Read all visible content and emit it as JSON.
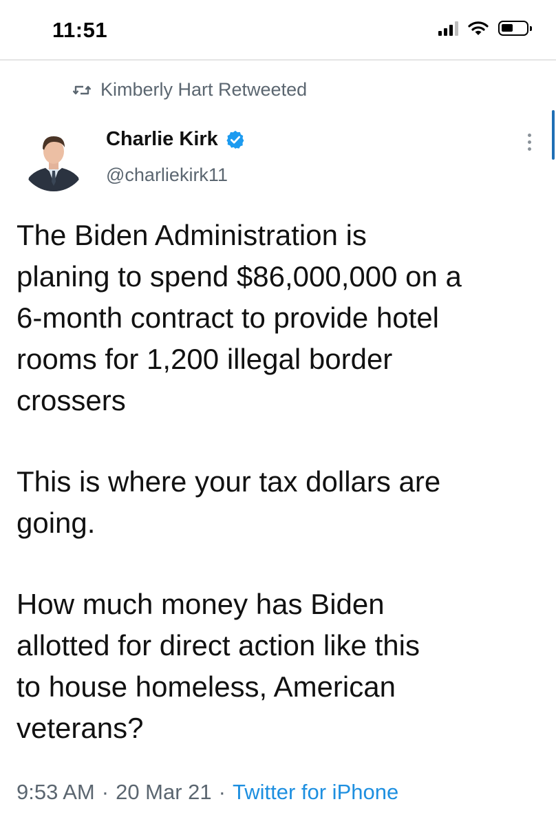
{
  "status_bar": {
    "time": "11:51",
    "icons": [
      "signal-bars-icon",
      "wifi-icon",
      "battery-icon"
    ]
  },
  "retweet": {
    "icon": "retweet-icon",
    "text": "Kimberly Hart Retweeted"
  },
  "author": {
    "display_name": "Charlie Kirk",
    "handle": "@charliekirk11",
    "verified": true,
    "verified_color": "#1d9bf0"
  },
  "tweet": {
    "paragraphs": [
      "The Biden Administration is\nplaning to spend $86,000,000 on a\n6-month contract to provide hotel\nrooms for 1,200 illegal border\ncrossers",
      "This is where your tax dollars are\ngoing.",
      "How much money has Biden\nallotted for direct action like this\nto house homeless, American\nveterans?"
    ]
  },
  "meta": {
    "time": "9:53 AM",
    "separator": "·",
    "date": "20 Mar 21",
    "source": "Twitter for iPhone"
  },
  "colors": {
    "link": "#1d8fe0",
    "muted_text": "#5b6670",
    "accent_scroll": "#1f6fb5"
  }
}
